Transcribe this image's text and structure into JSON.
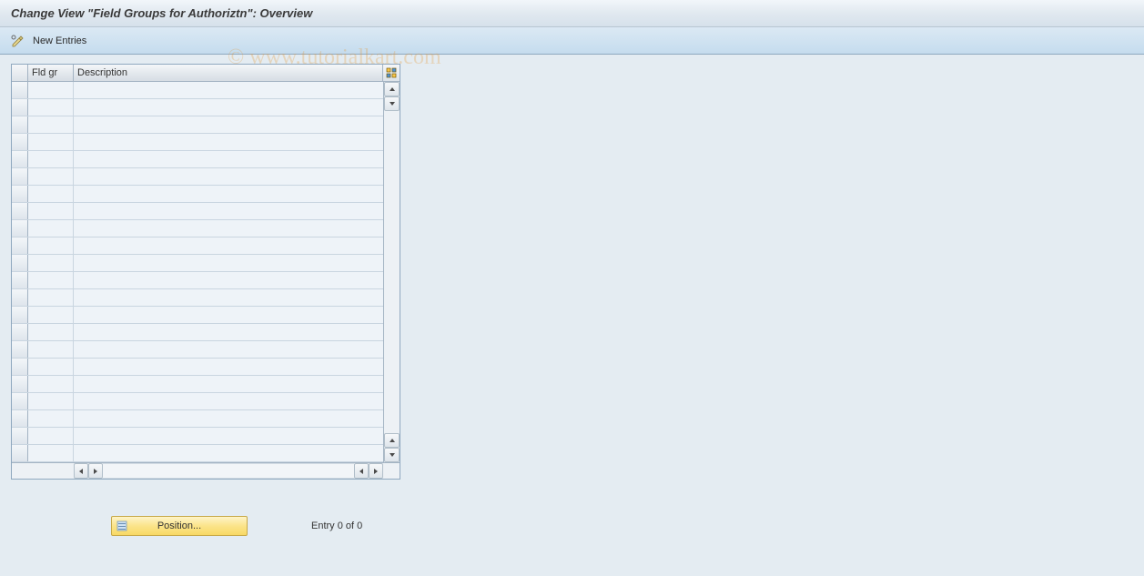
{
  "header": {
    "title": "Change View \"Field Groups for Authoriztn\": Overview"
  },
  "toolbar": {
    "toggle_icon": "toggle-edit-icon",
    "new_entries_label": "New Entries"
  },
  "table": {
    "columns": {
      "fldgr": "Fld gr",
      "description": "Description"
    },
    "row_count": 22,
    "rows": []
  },
  "footer": {
    "position_button_label": "Position...",
    "entry_text": "Entry 0 of 0"
  },
  "watermark": "© www.tutorialkart.com"
}
